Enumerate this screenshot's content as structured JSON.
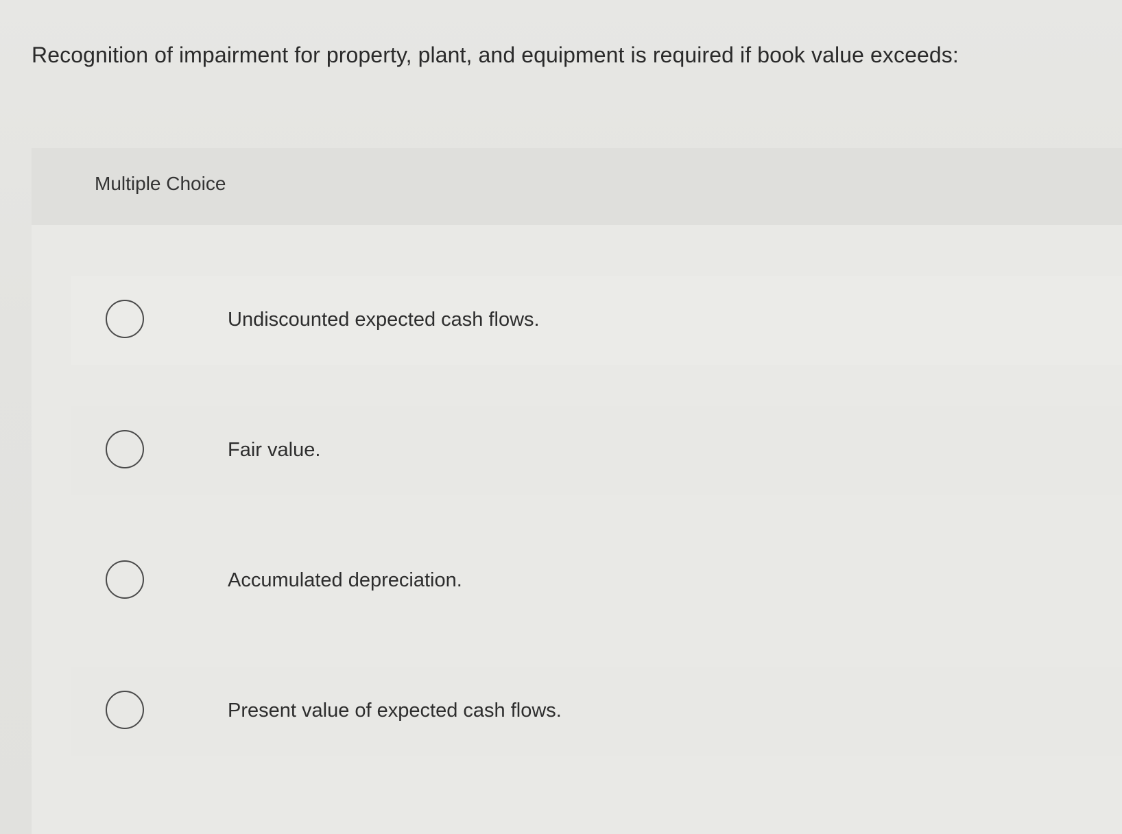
{
  "question": {
    "text": "Recognition of impairment for property, plant, and equipment is required if book value exceeds:"
  },
  "multiple_choice": {
    "label": "Multiple Choice",
    "options": [
      {
        "label": "Undiscounted expected cash flows.",
        "selected": false
      },
      {
        "label": "Fair value.",
        "selected": false
      },
      {
        "label": "Accumulated depreciation.",
        "selected": false
      },
      {
        "label": "Present value of expected cash flows.",
        "selected": false
      }
    ]
  }
}
